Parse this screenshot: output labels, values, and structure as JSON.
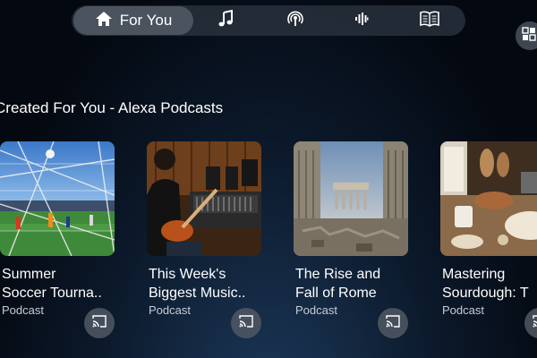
{
  "nav": {
    "home_label": "For You",
    "items": [
      {
        "icon": "music-note-icon"
      },
      {
        "icon": "podcast-icon"
      },
      {
        "icon": "audio-waveform-icon"
      },
      {
        "icon": "book-icon"
      }
    ]
  },
  "section": {
    "title": "Created For You - Alexa Podcasts"
  },
  "cards": [
    {
      "title": "Summer\nSoccer Tourna..",
      "type": "Podcast",
      "image": "soccer-match-image"
    },
    {
      "title": "This Week's\nBiggest Music..",
      "type": "Podcast",
      "image": "guitarist-studio-image"
    },
    {
      "title": "The Rise and\nFall of Rome",
      "type": "Podcast",
      "image": "roman-ruins-image"
    },
    {
      "title": "Mastering\nSourdough: T",
      "type": "Podcast",
      "image": "sourdough-kitchen-image"
    }
  ],
  "colors": {
    "accent": "#ffffff",
    "nav_bg": "#28303c",
    "background": "#0c1a2c"
  }
}
